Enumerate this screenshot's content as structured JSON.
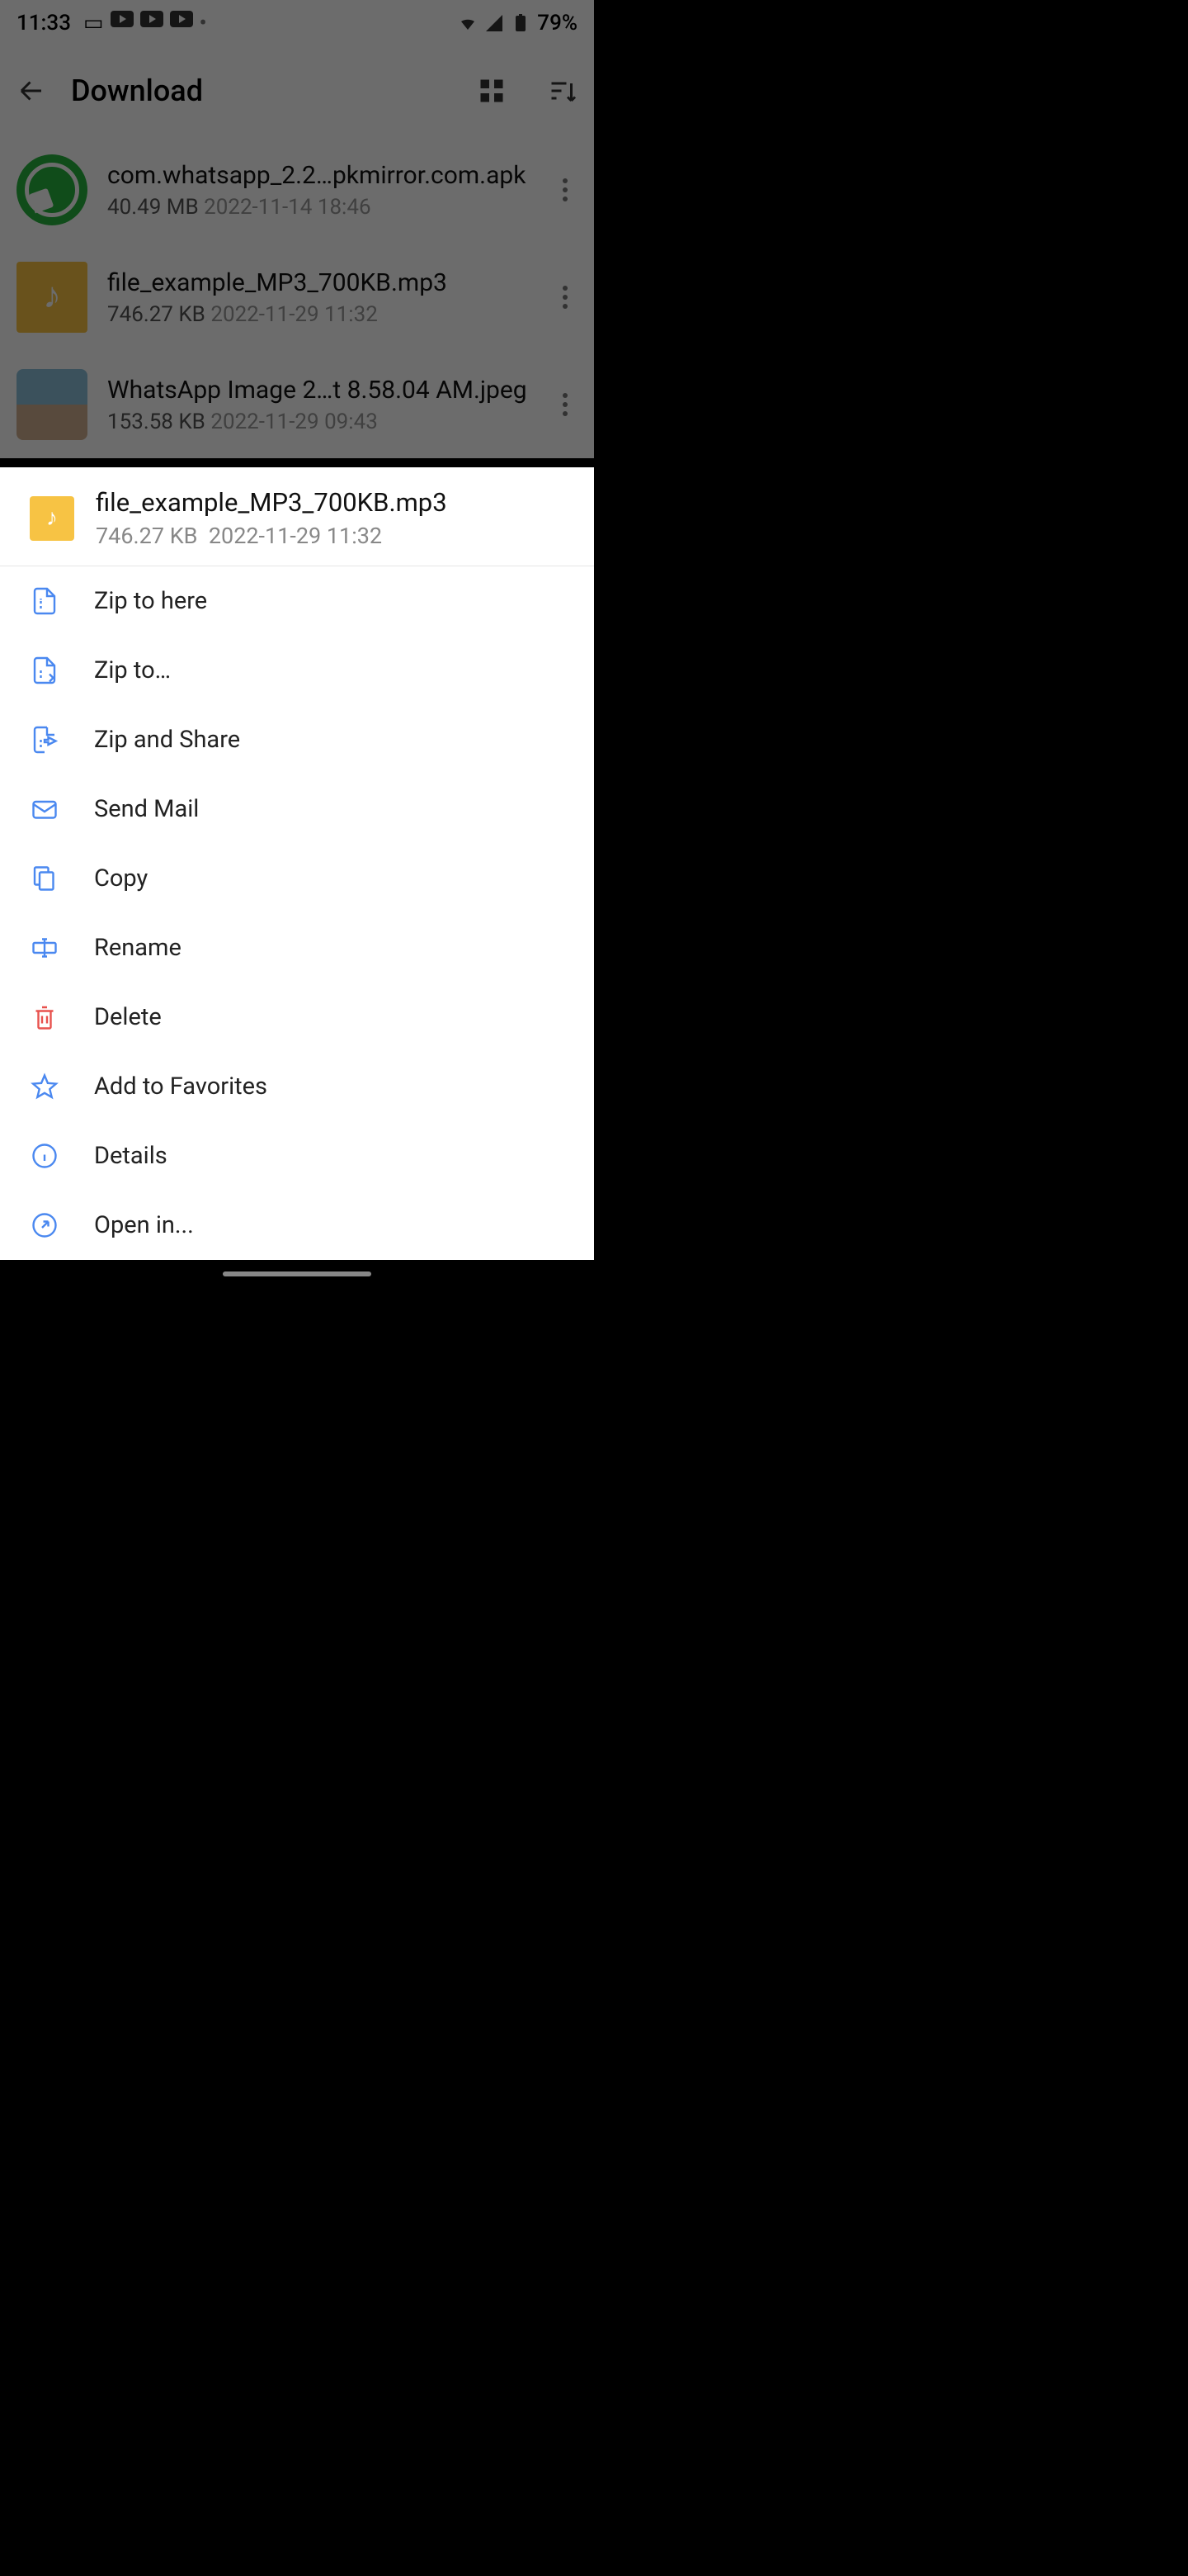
{
  "status": {
    "time": "11:33",
    "battery": "79%"
  },
  "appbar": {
    "title": "Download"
  },
  "files": [
    {
      "name": "com.whatsapp_2.2…pkmirror.com.apk",
      "size": "40.49 MB",
      "date": "2022-11-14 18:46",
      "icon": "whatsapp"
    },
    {
      "name": "file_example_MP3_700KB.mp3",
      "size": "746.27 KB",
      "date": "2022-11-29 11:32",
      "icon": "mp3"
    },
    {
      "name": "WhatsApp Image 2…t 8.58.04 AM.jpeg",
      "size": "153.58 KB",
      "date": "2022-11-29 09:43",
      "icon": "image"
    }
  ],
  "sheet": {
    "file": {
      "name": "file_example_MP3_700KB.mp3",
      "size": "746.27 KB",
      "date": "2022-11-29 11:32"
    },
    "menu": [
      {
        "id": "zip-here",
        "label": "Zip to here",
        "icon": "zip"
      },
      {
        "id": "zip-to",
        "label": "Zip to…",
        "icon": "zip-arrow"
      },
      {
        "id": "zip-share",
        "label": "Zip and Share",
        "icon": "zip-share"
      },
      {
        "id": "send-mail",
        "label": "Send Mail",
        "icon": "mail"
      },
      {
        "id": "copy",
        "label": "Copy",
        "icon": "copy"
      },
      {
        "id": "rename",
        "label": "Rename",
        "icon": "rename"
      },
      {
        "id": "delete",
        "label": "Delete",
        "icon": "delete",
        "danger": true
      },
      {
        "id": "fav",
        "label": "Add to Favorites",
        "icon": "star"
      },
      {
        "id": "details",
        "label": "Details",
        "icon": "info"
      },
      {
        "id": "open-in",
        "label": "Open in...",
        "icon": "external"
      }
    ]
  }
}
